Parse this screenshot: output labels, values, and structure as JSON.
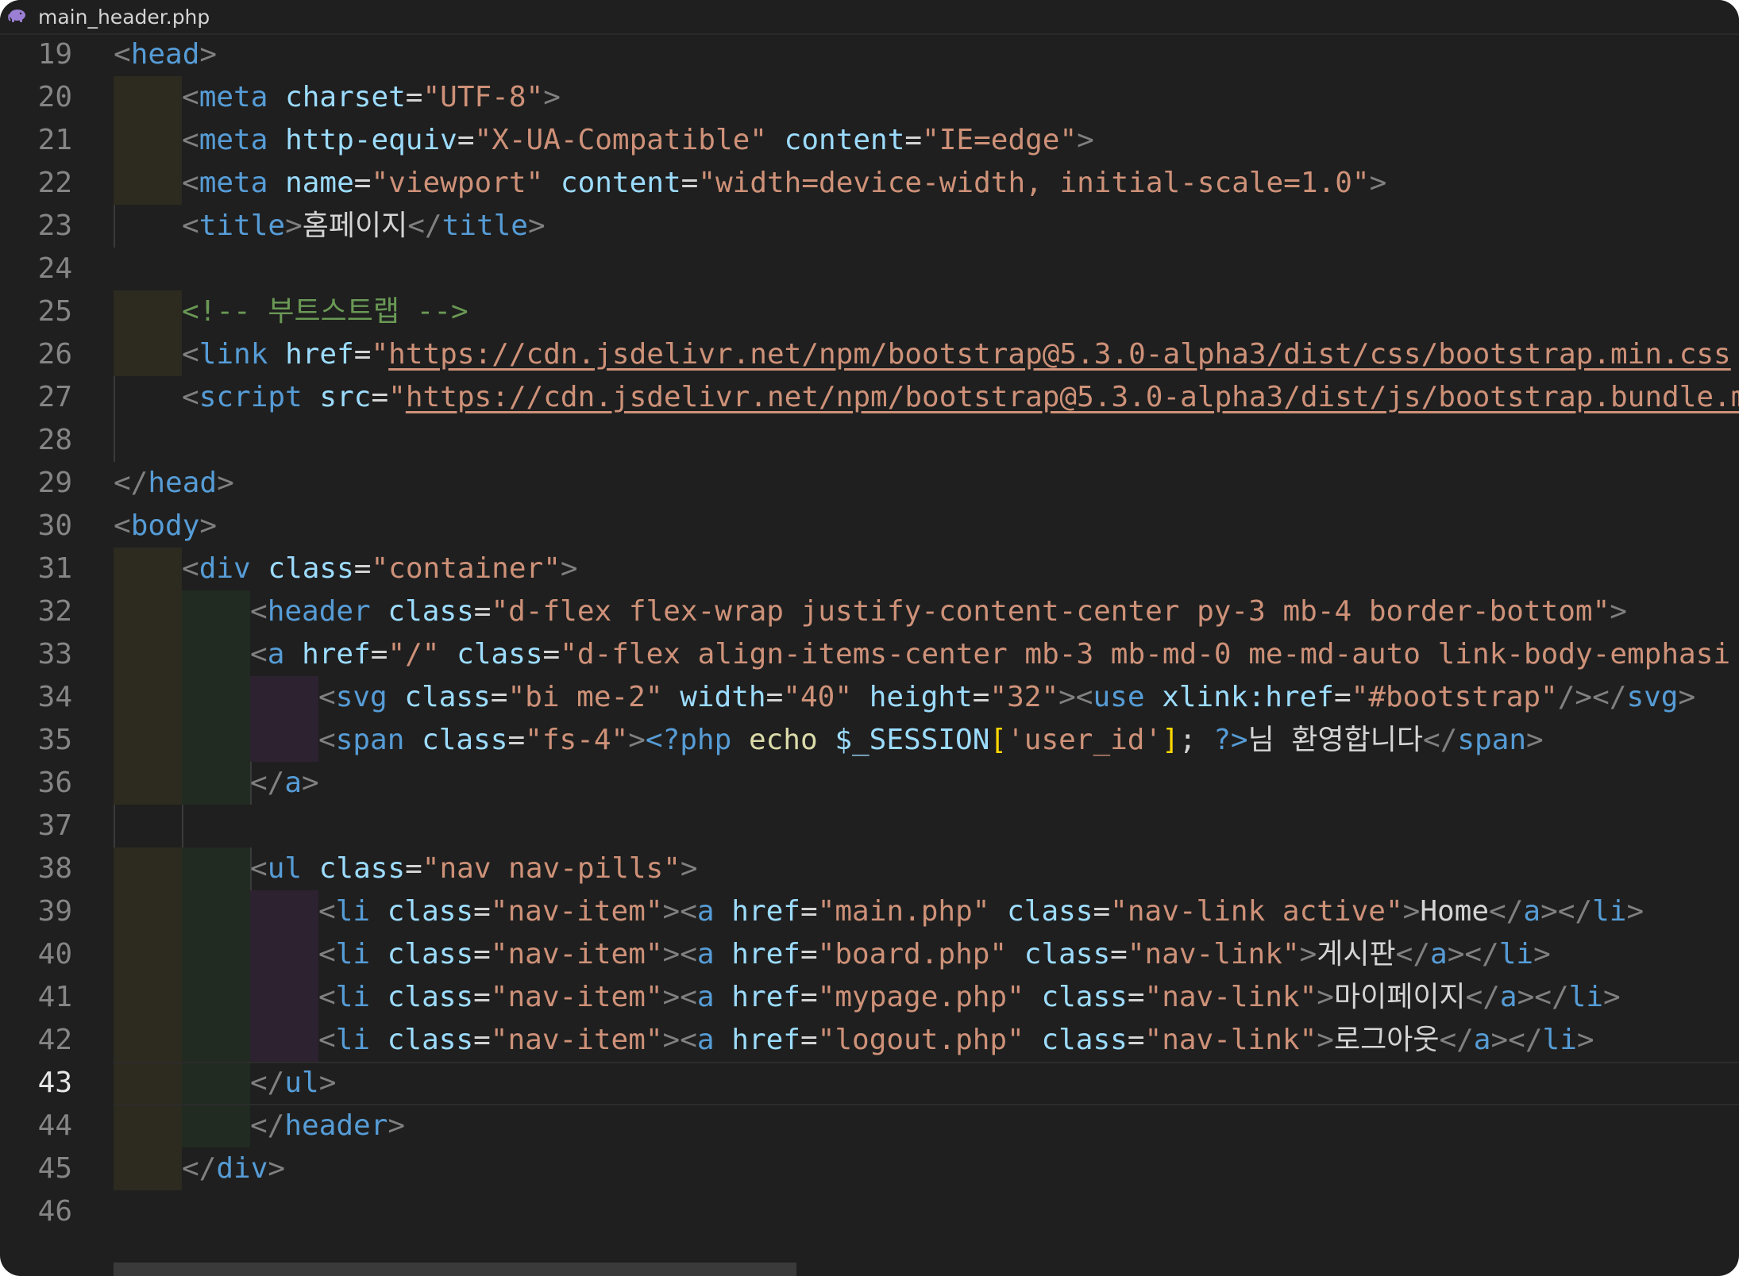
{
  "tab": {
    "title": "main_header.php",
    "icon": "php-elephant-icon"
  },
  "editor": {
    "active_line": 43,
    "line_numbers": [
      "19",
      "20",
      "21",
      "22",
      "23",
      "24",
      "25",
      "26",
      "27",
      "28",
      "29",
      "30",
      "31",
      "32",
      "33",
      "34",
      "35",
      "36",
      "37",
      "38",
      "39",
      "40",
      "41",
      "42",
      "43",
      "44",
      "45",
      "46"
    ],
    "lines": [
      [
        [
          "t",
          "<"
        ],
        [
          "tn",
          "head"
        ],
        [
          "t",
          ">"
        ]
      ],
      [
        [
          "t",
          "<"
        ],
        [
          "tn",
          "meta"
        ],
        [
          "tx",
          " "
        ],
        [
          "an",
          "charset"
        ],
        [
          "tx",
          "="
        ],
        [
          "av",
          "\"UTF-8\""
        ],
        [
          "t",
          ">"
        ]
      ],
      [
        [
          "t",
          "<"
        ],
        [
          "tn",
          "meta"
        ],
        [
          "tx",
          " "
        ],
        [
          "an",
          "http-equiv"
        ],
        [
          "tx",
          "="
        ],
        [
          "av",
          "\"X-UA-Compatible\""
        ],
        [
          "tx",
          " "
        ],
        [
          "an",
          "content"
        ],
        [
          "tx",
          "="
        ],
        [
          "av",
          "\"IE=edge\""
        ],
        [
          "t",
          ">"
        ]
      ],
      [
        [
          "t",
          "<"
        ],
        [
          "tn",
          "meta"
        ],
        [
          "tx",
          " "
        ],
        [
          "an",
          "name"
        ],
        [
          "tx",
          "="
        ],
        [
          "av",
          "\"viewport\""
        ],
        [
          "tx",
          " "
        ],
        [
          "an",
          "content"
        ],
        [
          "tx",
          "="
        ],
        [
          "av",
          "\"width=device-width, initial-scale=1.0\""
        ],
        [
          "t",
          ">"
        ]
      ],
      [
        [
          "t",
          "<"
        ],
        [
          "tn",
          "title"
        ],
        [
          "t",
          ">"
        ],
        [
          "tx",
          "홈페이지"
        ],
        [
          "t",
          "</"
        ],
        [
          "tn",
          "title"
        ],
        [
          "t",
          ">"
        ]
      ],
      [],
      [
        [
          "cm",
          "<!-- 부트스트랩 -->"
        ]
      ],
      [
        [
          "t",
          "<"
        ],
        [
          "tn",
          "link"
        ],
        [
          "tx",
          " "
        ],
        [
          "an",
          "href"
        ],
        [
          "tx",
          "="
        ],
        [
          "av",
          "\""
        ],
        [
          "url",
          "https://cdn.jsdelivr.net/npm/bootstrap@5.3.0-alpha3/dist/css/bootstrap.min.css"
        ]
      ],
      [
        [
          "t",
          "<"
        ],
        [
          "tn",
          "script"
        ],
        [
          "tx",
          " "
        ],
        [
          "an",
          "src"
        ],
        [
          "tx",
          "="
        ],
        [
          "av",
          "\""
        ],
        [
          "url",
          "https://cdn.jsdelivr.net/npm/bootstrap@5.3.0-alpha3/dist/js/bootstrap.bundle.m"
        ]
      ],
      [],
      [
        [
          "t",
          "</"
        ],
        [
          "tn",
          "head"
        ],
        [
          "t",
          ">"
        ]
      ],
      [
        [
          "t",
          "<"
        ],
        [
          "tn",
          "body"
        ],
        [
          "t",
          ">"
        ]
      ],
      [
        [
          "t",
          "<"
        ],
        [
          "tn",
          "div"
        ],
        [
          "tx",
          " "
        ],
        [
          "an",
          "class"
        ],
        [
          "tx",
          "="
        ],
        [
          "av",
          "\"container\""
        ],
        [
          "t",
          ">"
        ]
      ],
      [
        [
          "t",
          "<"
        ],
        [
          "tn",
          "header"
        ],
        [
          "tx",
          " "
        ],
        [
          "an",
          "class"
        ],
        [
          "tx",
          "="
        ],
        [
          "av",
          "\"d-flex flex-wrap justify-content-center py-3 mb-4 border-bottom\""
        ],
        [
          "t",
          ">"
        ]
      ],
      [
        [
          "t",
          "<"
        ],
        [
          "tn",
          "a"
        ],
        [
          "tx",
          " "
        ],
        [
          "an",
          "href"
        ],
        [
          "tx",
          "="
        ],
        [
          "av",
          "\"/\""
        ],
        [
          "tx",
          " "
        ],
        [
          "an",
          "class"
        ],
        [
          "tx",
          "="
        ],
        [
          "av",
          "\"d-flex align-items-center mb-3 mb-md-0 me-md-auto link-body-emphasi"
        ]
      ],
      [
        [
          "t",
          "<"
        ],
        [
          "tn",
          "svg"
        ],
        [
          "tx",
          " "
        ],
        [
          "an",
          "class"
        ],
        [
          "tx",
          "="
        ],
        [
          "av",
          "\"bi me-2\""
        ],
        [
          "tx",
          " "
        ],
        [
          "an",
          "width"
        ],
        [
          "tx",
          "="
        ],
        [
          "av",
          "\"40\""
        ],
        [
          "tx",
          " "
        ],
        [
          "an",
          "height"
        ],
        [
          "tx",
          "="
        ],
        [
          "av",
          "\"32\""
        ],
        [
          "t",
          "><"
        ],
        [
          "tn",
          "use"
        ],
        [
          "tx",
          " "
        ],
        [
          "an",
          "xlink:href"
        ],
        [
          "tx",
          "="
        ],
        [
          "av",
          "\"#bootstrap\""
        ],
        [
          "t",
          "/></"
        ],
        [
          "tn",
          "svg"
        ],
        [
          "t",
          ">"
        ]
      ],
      [
        [
          "t",
          "<"
        ],
        [
          "tn",
          "span"
        ],
        [
          "tx",
          " "
        ],
        [
          "an",
          "class"
        ],
        [
          "tx",
          "="
        ],
        [
          "av",
          "\"fs-4\""
        ],
        [
          "t",
          ">"
        ],
        [
          "php",
          "<?php"
        ],
        [
          "tx",
          " "
        ],
        [
          "fn",
          "echo"
        ],
        [
          "tx",
          " "
        ],
        [
          "var",
          "$_SESSION"
        ],
        [
          "br",
          "["
        ],
        [
          "av",
          "'user_id'"
        ],
        [
          "br",
          "]"
        ],
        [
          "pun",
          "; "
        ],
        [
          "php",
          "?>"
        ],
        [
          "tx",
          "님 환영합니다"
        ],
        [
          "t",
          "</"
        ],
        [
          "tn",
          "span"
        ],
        [
          "t",
          ">"
        ]
      ],
      [
        [
          "t",
          "</"
        ],
        [
          "tn",
          "a"
        ],
        [
          "t",
          ">"
        ]
      ],
      [],
      [
        [
          "t",
          "<"
        ],
        [
          "tn",
          "ul"
        ],
        [
          "tx",
          " "
        ],
        [
          "an",
          "class"
        ],
        [
          "tx",
          "="
        ],
        [
          "av",
          "\"nav nav-pills\""
        ],
        [
          "t",
          ">"
        ]
      ],
      [
        [
          "t",
          "<"
        ],
        [
          "tn",
          "li"
        ],
        [
          "tx",
          " "
        ],
        [
          "an",
          "class"
        ],
        [
          "tx",
          "="
        ],
        [
          "av",
          "\"nav-item\""
        ],
        [
          "t",
          "><"
        ],
        [
          "tn",
          "a"
        ],
        [
          "tx",
          " "
        ],
        [
          "an",
          "href"
        ],
        [
          "tx",
          "="
        ],
        [
          "av",
          "\"main.php\""
        ],
        [
          "tx",
          " "
        ],
        [
          "an",
          "class"
        ],
        [
          "tx",
          "="
        ],
        [
          "av",
          "\"nav-link active\""
        ],
        [
          "t",
          ">"
        ],
        [
          "tx",
          "Home"
        ],
        [
          "t",
          "</"
        ],
        [
          "tn",
          "a"
        ],
        [
          "t",
          "></"
        ],
        [
          "tn",
          "li"
        ],
        [
          "t",
          ">"
        ]
      ],
      [
        [
          "t",
          "<"
        ],
        [
          "tn",
          "li"
        ],
        [
          "tx",
          " "
        ],
        [
          "an",
          "class"
        ],
        [
          "tx",
          "="
        ],
        [
          "av",
          "\"nav-item\""
        ],
        [
          "t",
          "><"
        ],
        [
          "tn",
          "a"
        ],
        [
          "tx",
          " "
        ],
        [
          "an",
          "href"
        ],
        [
          "tx",
          "="
        ],
        [
          "av",
          "\"board.php\""
        ],
        [
          "tx",
          " "
        ],
        [
          "an",
          "class"
        ],
        [
          "tx",
          "="
        ],
        [
          "av",
          "\"nav-link\""
        ],
        [
          "t",
          ">"
        ],
        [
          "tx",
          "게시판"
        ],
        [
          "t",
          "</"
        ],
        [
          "tn",
          "a"
        ],
        [
          "t",
          "></"
        ],
        [
          "tn",
          "li"
        ],
        [
          "t",
          ">"
        ]
      ],
      [
        [
          "t",
          "<"
        ],
        [
          "tn",
          "li"
        ],
        [
          "tx",
          " "
        ],
        [
          "an",
          "class"
        ],
        [
          "tx",
          "="
        ],
        [
          "av",
          "\"nav-item\""
        ],
        [
          "t",
          "><"
        ],
        [
          "tn",
          "a"
        ],
        [
          "tx",
          " "
        ],
        [
          "an",
          "href"
        ],
        [
          "tx",
          "="
        ],
        [
          "av",
          "\"mypage.php\""
        ],
        [
          "tx",
          " "
        ],
        [
          "an",
          "class"
        ],
        [
          "tx",
          "="
        ],
        [
          "av",
          "\"nav-link\""
        ],
        [
          "t",
          ">"
        ],
        [
          "tx",
          "마이페이지"
        ],
        [
          "t",
          "</"
        ],
        [
          "tn",
          "a"
        ],
        [
          "t",
          "></"
        ],
        [
          "tn",
          "li"
        ],
        [
          "t",
          ">"
        ]
      ],
      [
        [
          "t",
          "<"
        ],
        [
          "tn",
          "li"
        ],
        [
          "tx",
          " "
        ],
        [
          "an",
          "class"
        ],
        [
          "tx",
          "="
        ],
        [
          "av",
          "\"nav-item\""
        ],
        [
          "t",
          "><"
        ],
        [
          "tn",
          "a"
        ],
        [
          "tx",
          " "
        ],
        [
          "an",
          "href"
        ],
        [
          "tx",
          "="
        ],
        [
          "av",
          "\"logout.php\""
        ],
        [
          "tx",
          " "
        ],
        [
          "an",
          "class"
        ],
        [
          "tx",
          "="
        ],
        [
          "av",
          "\"nav-link\""
        ],
        [
          "t",
          ">"
        ],
        [
          "tx",
          "로그아웃"
        ],
        [
          "t",
          "</"
        ],
        [
          "tn",
          "a"
        ],
        [
          "t",
          "></"
        ],
        [
          "tn",
          "li"
        ],
        [
          "t",
          ">"
        ]
      ],
      [
        [
          "t",
          "</"
        ],
        [
          "tn",
          "ul"
        ],
        [
          "t",
          ">"
        ]
      ],
      [
        [
          "t",
          "</"
        ],
        [
          "tn",
          "header"
        ],
        [
          "t",
          ">"
        ]
      ],
      [
        [
          "t",
          "</"
        ],
        [
          "tn",
          "div"
        ],
        [
          "t",
          ">"
        ]
      ],
      []
    ]
  }
}
